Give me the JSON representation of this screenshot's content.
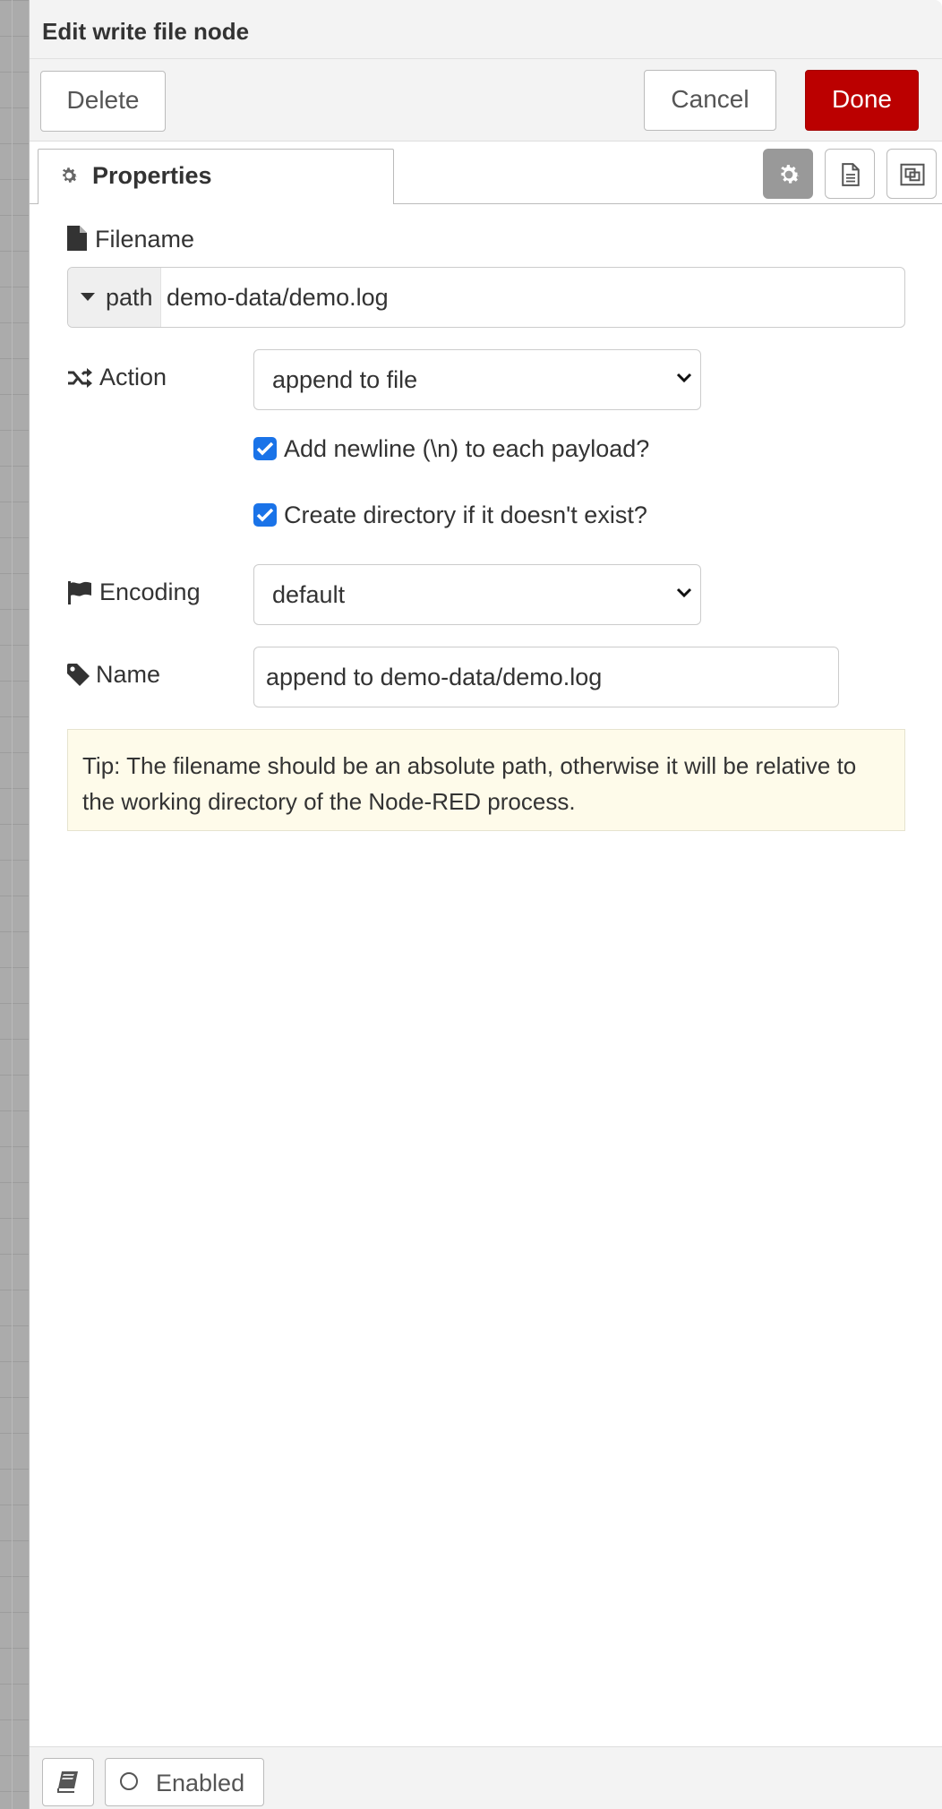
{
  "dialog": {
    "title": "Edit write file node"
  },
  "toolbar": {
    "delete_label": "Delete",
    "cancel_label": "Cancel",
    "done_label": "Done"
  },
  "tabs": {
    "properties_label": "Properties",
    "properties_icon": "gear-icon",
    "description_icon": "file-text-icon",
    "appearance_icon": "window-restore-icon"
  },
  "form": {
    "filename": {
      "label": "Filename",
      "icon": "file-icon",
      "type_label": "path",
      "value": "demo-data/demo.log"
    },
    "action": {
      "label": "Action",
      "icon": "random-icon",
      "selected": "append to file"
    },
    "checks": {
      "newline_label": "Add newline (\\n) to each payload?",
      "newline_checked": true,
      "createdir_label": "Create directory if it doesn't exist?",
      "createdir_checked": true
    },
    "encoding": {
      "label": "Encoding",
      "icon": "flag-icon",
      "selected": "default"
    },
    "name": {
      "label": "Name",
      "icon": "tag-icon",
      "value": "append to demo-data/demo.log"
    },
    "tip": "Tip: The filename should be an absolute path, otherwise it will be relative to the working directory of the Node-RED process."
  },
  "footer": {
    "enabled_label": "Enabled",
    "book_icon": "book-icon"
  },
  "colors": {
    "done_button": "#bb0000",
    "checkbox": "#1a73e8",
    "tip_background": "#fefbea"
  }
}
